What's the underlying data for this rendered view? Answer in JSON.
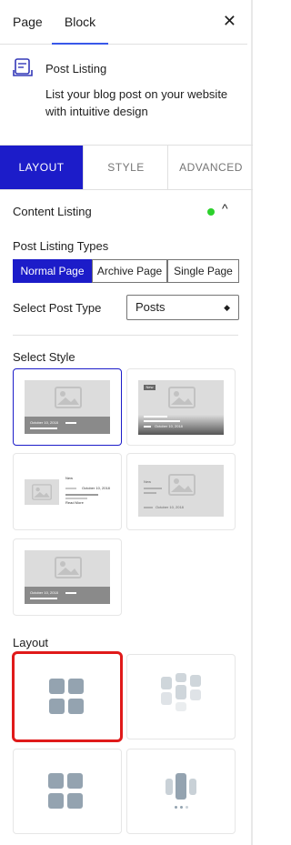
{
  "tabs": {
    "page": "Page",
    "block": "Block"
  },
  "block": {
    "title": "Post Listing",
    "description": "List your blog post on your website with intuitive design"
  },
  "panel_tabs": {
    "layout": "LAYOUT",
    "style": "STYLE",
    "advanced": "ADVANCED"
  },
  "content_listing": {
    "title": "Content Listing"
  },
  "post_listing_types": {
    "label": "Post Listing Types",
    "options": [
      "Normal Page",
      "Archive Page",
      "Single Page"
    ]
  },
  "select_post_type": {
    "label": "Select Post Type",
    "value": "Posts"
  },
  "select_style": {
    "label": "Select Style",
    "date": "October 10, 2018",
    "new_label": "New",
    "read_more": "Read More"
  },
  "layout": {
    "label": "Layout"
  },
  "colors": {
    "accent": "#1c1cc9",
    "highlight": "#e01a1a",
    "status_dot": "#2cd12c"
  }
}
